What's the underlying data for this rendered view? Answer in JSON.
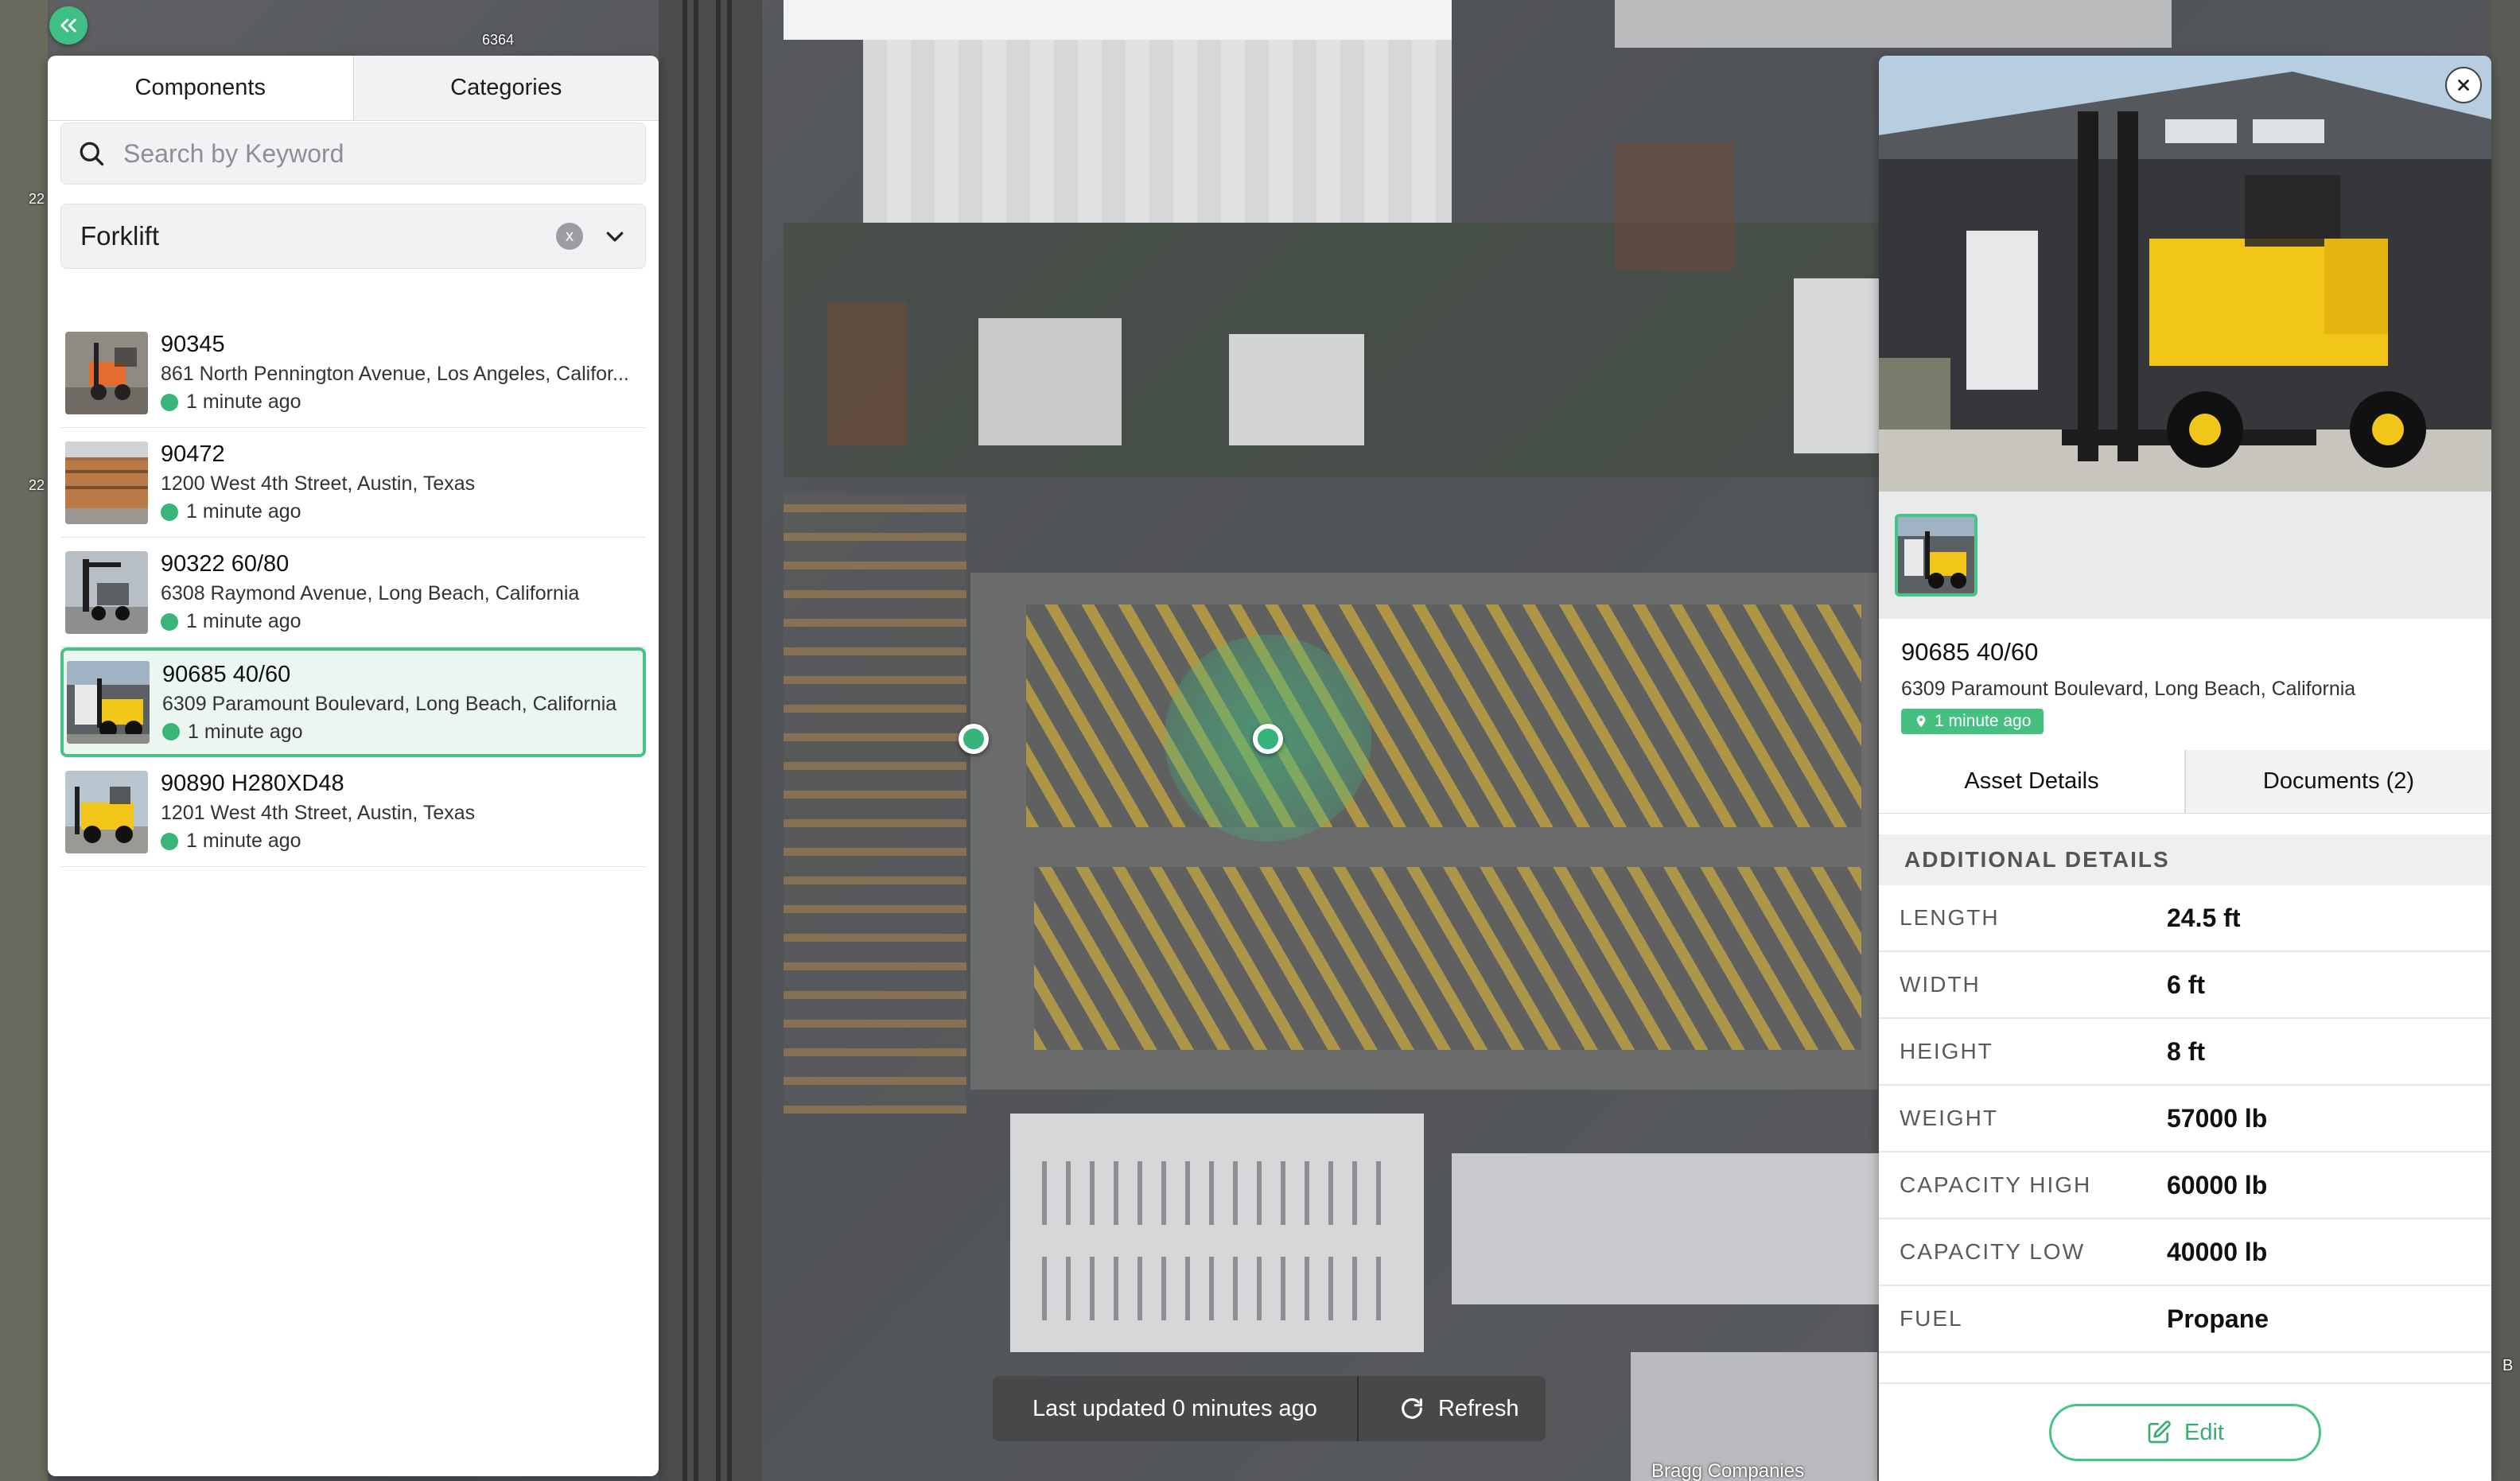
{
  "map": {
    "labels": [
      "6364",
      "22",
      "22",
      "B"
    ],
    "credit": "Bragg Companies"
  },
  "left_panel": {
    "tabs": [
      {
        "label": "Components",
        "active": true
      },
      {
        "label": "Categories",
        "active": false
      }
    ],
    "search": {
      "placeholder": "Search by Keyword",
      "value": ""
    },
    "filter": {
      "value": "Forklift",
      "clear": "x"
    },
    "items": [
      {
        "name": "90345",
        "address": "861 North Pennington Avenue, Los Angeles, Califor...",
        "time": "1 minute ago",
        "selected": false
      },
      {
        "name": "90472",
        "address": "1200 West 4th Street, Austin, Texas",
        "time": "1 minute ago",
        "selected": false
      },
      {
        "name": "90322 60/80",
        "address": "6308 Raymond Avenue, Long Beach, California",
        "time": "1 minute ago",
        "selected": false
      },
      {
        "name": "90685 40/60",
        "address": "6309 Paramount Boulevard, Long Beach, California",
        "time": "1 minute ago",
        "selected": true
      },
      {
        "name": "90890 H280XD48",
        "address": "1201 West 4th Street, Austin, Texas",
        "time": "1 minute ago",
        "selected": false
      }
    ]
  },
  "status": {
    "last_updated": "Last updated 0 minutes ago",
    "refresh_label": "Refresh"
  },
  "detail": {
    "name": "90685 40/60",
    "address": "6309 Paramount Boulevard, Long Beach, California",
    "time": "1 minute ago",
    "tabs": [
      {
        "label": "Asset Details",
        "active": true
      },
      {
        "label": "Documents (2)",
        "active": false
      }
    ],
    "section_title": "ADDITIONAL DETAILS",
    "rows": [
      {
        "key": "LENGTH",
        "value": "24.5 ft"
      },
      {
        "key": "WIDTH",
        "value": "6 ft"
      },
      {
        "key": "HEIGHT",
        "value": "8 ft"
      },
      {
        "key": "WEIGHT",
        "value": "57000 lb"
      },
      {
        "key": "CAPACITY HIGH",
        "value": "60000 lb"
      },
      {
        "key": "CAPACITY LOW",
        "value": "40000 lb"
      },
      {
        "key": "FUEL",
        "value": "Propane"
      }
    ],
    "edit_label": "Edit"
  },
  "colors": {
    "accent": "#47c485",
    "status_green": "#39b579",
    "forklift_yellow": "#f2c619"
  }
}
